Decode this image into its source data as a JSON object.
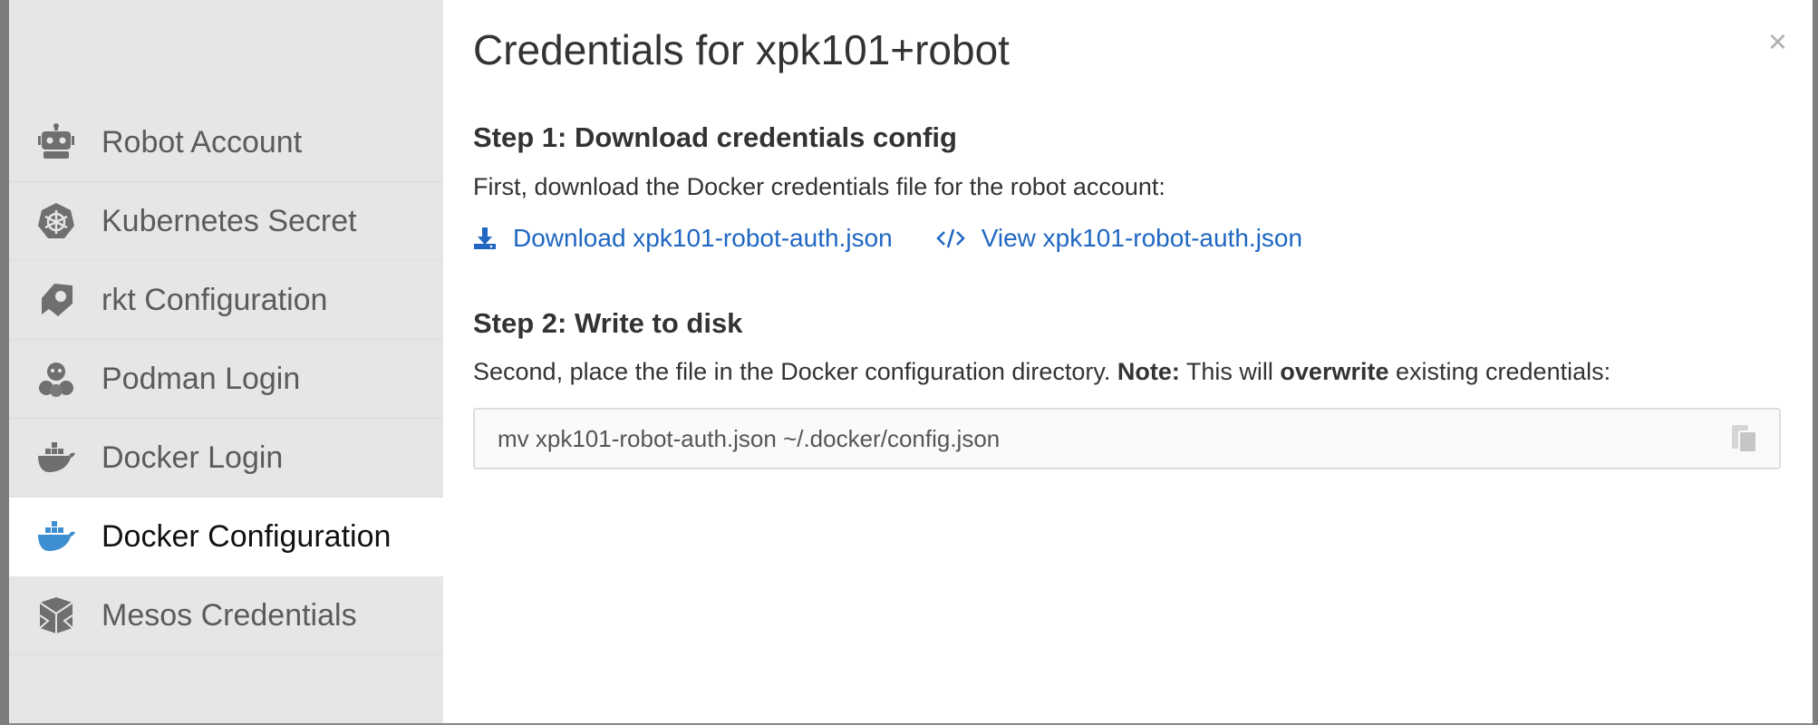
{
  "modal": {
    "title": "Credentials for xpk101+robot",
    "close_label": "×"
  },
  "sidebar": {
    "items": [
      {
        "label": "Robot Account",
        "icon": "robot-icon",
        "active": false
      },
      {
        "label": "Kubernetes Secret",
        "icon": "kubernetes-icon",
        "active": false
      },
      {
        "label": "rkt Configuration",
        "icon": "rkt-icon",
        "active": false
      },
      {
        "label": "Podman Login",
        "icon": "podman-icon",
        "active": false
      },
      {
        "label": "Docker Login",
        "icon": "docker-icon",
        "active": false
      },
      {
        "label": "Docker Configuration",
        "icon": "docker-icon",
        "active": true
      },
      {
        "label": "Mesos Credentials",
        "icon": "mesos-icon",
        "active": false
      }
    ]
  },
  "step1": {
    "heading": "Step 1: Download credentials config",
    "text": "First, download the Docker credentials file for the robot account:",
    "download_link": "Download xpk101-robot-auth.json",
    "view_link": "View xpk101-robot-auth.json"
  },
  "step2": {
    "heading": "Step 2: Write to disk",
    "text_before": "Second, place the file in the Docker configuration directory. ",
    "note_label": "Note:",
    "text_middle": " This will ",
    "overwrite_word": "overwrite",
    "text_after": " existing credentials:",
    "command": "mv xpk101-robot-auth.json ~/.docker/config.json"
  },
  "colors": {
    "link": "#1f67c2",
    "sidebar_bg": "#e6e6e6",
    "active_icon": "#3d8fd1",
    "inactive_icon": "#6f6f6f"
  }
}
